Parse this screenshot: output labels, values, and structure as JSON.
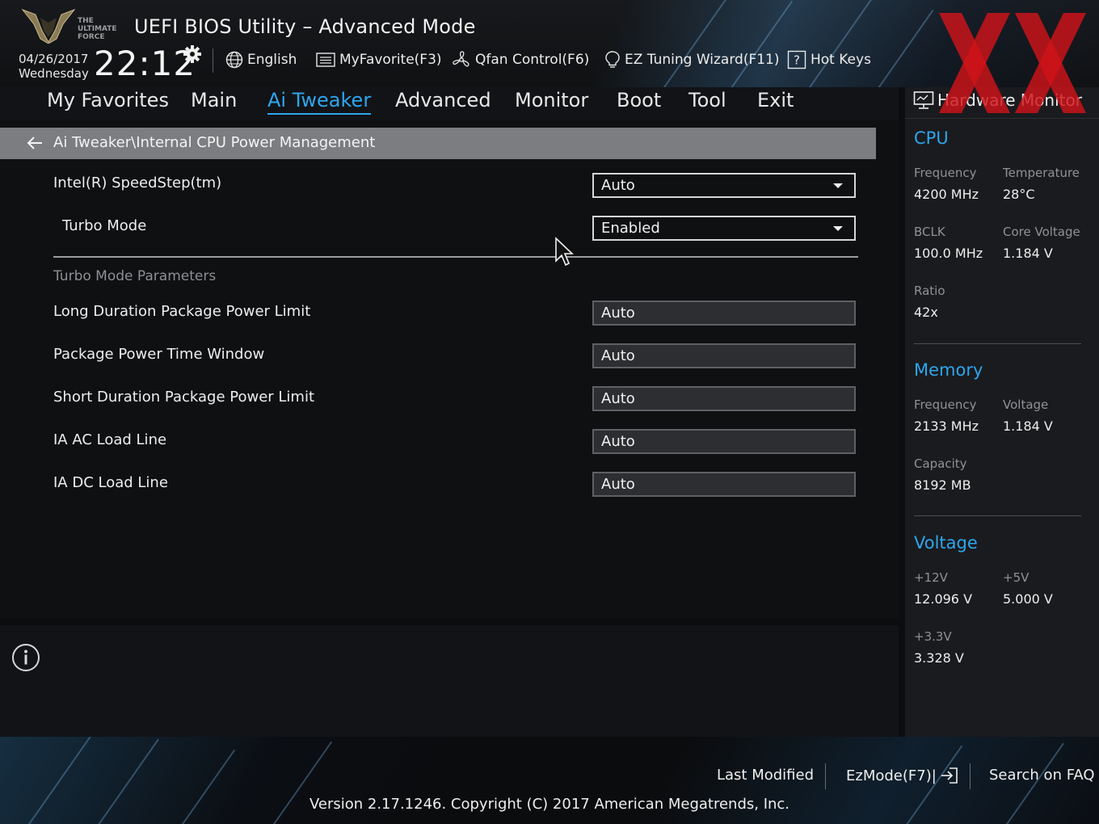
{
  "header": {
    "brand_lines": [
      "THE",
      "ULTIMATE",
      "FORCE"
    ],
    "title": "UEFI BIOS Utility – Advanced Mode",
    "date": "04/26/2017",
    "weekday": "Wednesday",
    "time": "22:12",
    "buttons": [
      {
        "label": "English",
        "icon": "globe-icon"
      },
      {
        "label": "MyFavorite(F3)",
        "icon": "favorite-list-icon"
      },
      {
        "label": "Qfan Control(F6)",
        "icon": "fan-icon"
      },
      {
        "label": "EZ Tuning Wizard(F11)",
        "icon": "lightbulb-icon"
      },
      {
        "label": "Hot Keys",
        "icon": "question-box-icon"
      }
    ]
  },
  "tabs": [
    {
      "label": "My Favorites",
      "active": false
    },
    {
      "label": "Main",
      "active": false
    },
    {
      "label": "Ai Tweaker",
      "active": true
    },
    {
      "label": "Advanced",
      "active": false
    },
    {
      "label": "Monitor",
      "active": false
    },
    {
      "label": "Boot",
      "active": false
    },
    {
      "label": "Tool",
      "active": false
    },
    {
      "label": "Exit",
      "active": false
    }
  ],
  "breadcrumb": "Ai Tweaker\\Internal CPU Power Management",
  "settings": {
    "speedstep": {
      "label": "Intel(R) SpeedStep(tm)",
      "value": "Auto"
    },
    "turbo_mode": {
      "label": "Turbo Mode",
      "value": "Enabled"
    },
    "section_title": "Turbo Mode Parameters",
    "params": [
      {
        "label": "Long Duration Package Power Limit",
        "value": "Auto"
      },
      {
        "label": "Package Power Time Window",
        "value": "Auto"
      },
      {
        "label": "Short Duration Package Power Limit",
        "value": "Auto"
      },
      {
        "label": "IA AC Load Line",
        "value": "Auto"
      },
      {
        "label": "IA DC Load Line",
        "value": "Auto"
      }
    ]
  },
  "hardware_monitor": {
    "title": "Hardware Monitor",
    "cpu": {
      "title": "CPU",
      "frequency_label": "Frequency",
      "frequency": "4200 MHz",
      "temperature_label": "Temperature",
      "temperature": "28°C",
      "bclk_label": "BCLK",
      "bclk": "100.0 MHz",
      "core_voltage_label": "Core Voltage",
      "core_voltage": "1.184 V",
      "ratio_label": "Ratio",
      "ratio": "42x"
    },
    "memory": {
      "title": "Memory",
      "frequency_label": "Frequency",
      "frequency": "2133 MHz",
      "voltage_label": "Voltage",
      "voltage": "1.184 V",
      "capacity_label": "Capacity",
      "capacity": "8192 MB"
    },
    "voltage": {
      "title": "Voltage",
      "v12_label": "+12V",
      "v12": "12.096 V",
      "v5_label": "+5V",
      "v5": "5.000 V",
      "v33_label": "+3.3V",
      "v33": "3.328 V"
    }
  },
  "footer": {
    "last_modified": "Last Modified",
    "ezmode": "EzMode(F7)|",
    "search_faq": "Search on FAQ",
    "version": "Version 2.17.1246. Copyright (C) 2017 American Megatrends, Inc."
  },
  "colors": {
    "accent": "#2ea6ee",
    "watermark": "#d0131a",
    "breadcrumb_bar": "#7b7d80",
    "panel_bg": "#0f1012"
  }
}
